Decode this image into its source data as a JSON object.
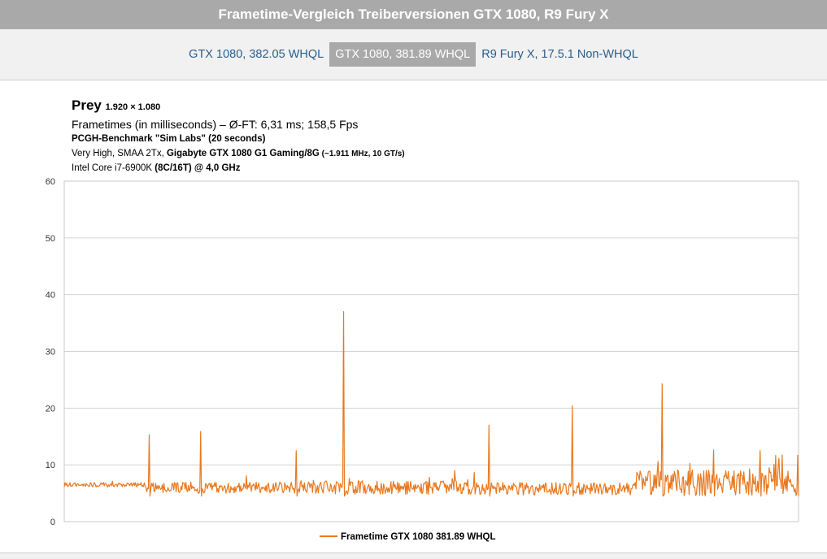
{
  "page": {
    "title": "Frametime-Vergleich Treiberversionen GTX 1080, R9 Fury X",
    "tabs": [
      {
        "label": "GTX 1080, 382.05 WHQL",
        "active": false
      },
      {
        "label": "GTX 1080, 381.89 WHQL",
        "active": true
      },
      {
        "label": "R9 Fury X, 17.5.1 Non-WHQL",
        "active": false
      }
    ]
  },
  "header": {
    "game": "Prey",
    "resolution": "1.920 × 1.080",
    "subtitle": "Frametimes (in milliseconds) – Ø-FT: 6,31 ms; 158,5 Fps",
    "benchmark": "PCGH-Benchmark \"Sim Labs\" (20 seconds)",
    "settings_prefix": "Very High, SMAA 2Tx, ",
    "gpu": "Gigabyte GTX 1080 G1 Gaming/8G",
    "gpu_specs": " (~1.911 MHz, 10 GT/s)",
    "cpu_prefix": "Intel Core i7-6900K ",
    "cpu_specs": "(8C/16T) @ 4,0 GHz"
  },
  "chart_data": {
    "type": "line",
    "title": "Prey 1.920 × 1.080",
    "subtitle": "Frametimes (in milliseconds) – Ø-FT: 6,31 ms; 158,5 Fps",
    "xlabel": "",
    "ylabel": "",
    "ylim": [
      0,
      60
    ],
    "yticks": [
      "0",
      "10",
      "20",
      "30",
      "40",
      "50",
      "60"
    ],
    "grid": true,
    "legend": "bottom-center",
    "series_color": "#e8781e",
    "sample_count": 900,
    "base_segments": [
      {
        "x": [
          0,
          100
        ],
        "mean": 6.5,
        "noise": 0.4
      },
      {
        "x": [
          100,
          300
        ],
        "mean": 6.0,
        "noise": 1.0
      },
      {
        "x": [
          300,
          500
        ],
        "mean": 6.0,
        "noise": 1.2
      },
      {
        "x": [
          500,
          700
        ],
        "mean": 5.8,
        "noise": 1.1
      },
      {
        "x": [
          700,
          900
        ],
        "mean": 6.8,
        "noise": 2.3
      }
    ],
    "spikes": [
      {
        "x": 104,
        "y": 15.3
      },
      {
        "x": 167,
        "y": 15.9
      },
      {
        "x": 284,
        "y": 12.5
      },
      {
        "x": 342,
        "y": 37.0
      },
      {
        "x": 520,
        "y": 17.0
      },
      {
        "x": 622,
        "y": 20.4
      },
      {
        "x": 732,
        "y": 24.3
      },
      {
        "x": 795,
        "y": 12.6
      },
      {
        "x": 852,
        "y": 12.5
      },
      {
        "x": 898,
        "y": 11.7
      }
    ],
    "series": [
      {
        "name": "Frametime GTX 1080 381.89 WHQL"
      }
    ]
  }
}
